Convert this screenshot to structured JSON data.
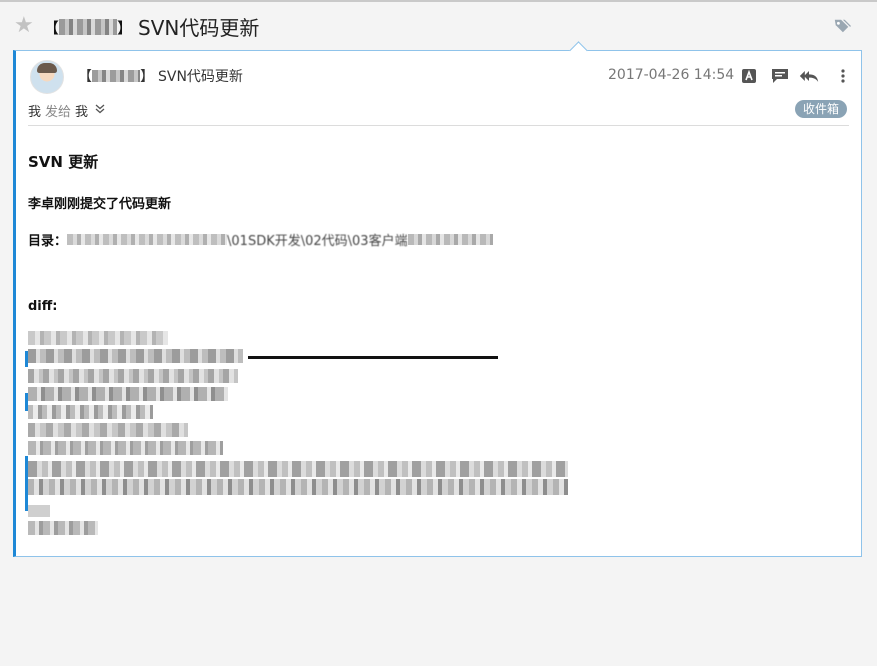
{
  "window": {
    "subject": "SVN代码更新",
    "sender_bracket_left": "【",
    "sender_bracket_right": "】"
  },
  "icons": {
    "star": "star-icon",
    "tag": "tag-icon",
    "translate": "translate-icon",
    "comment": "comment-icon",
    "reply_all": "reply-all-icon",
    "more": "more-vertical-icon"
  },
  "header": {
    "sender_prefix": "【",
    "sender_suffix": "】",
    "subject": "SVN代码更新",
    "date": "2017-04-26 14:54",
    "recipient_from": "我",
    "sent_to_label": "发给",
    "recipient_to": "我",
    "folder": "收件箱"
  },
  "body": {
    "title": "SVN 更新",
    "line1": "李卓刚刚提交了代码更新",
    "dir_label": "目录：",
    "dir_visible_fragment": "\\01SDK开发\\02代码\\03客户端",
    "diff_label": "diff:"
  },
  "colors": {
    "accent": "#1e88d6",
    "badge": "#8aa3b5",
    "card_border": "#8fc3ea"
  }
}
